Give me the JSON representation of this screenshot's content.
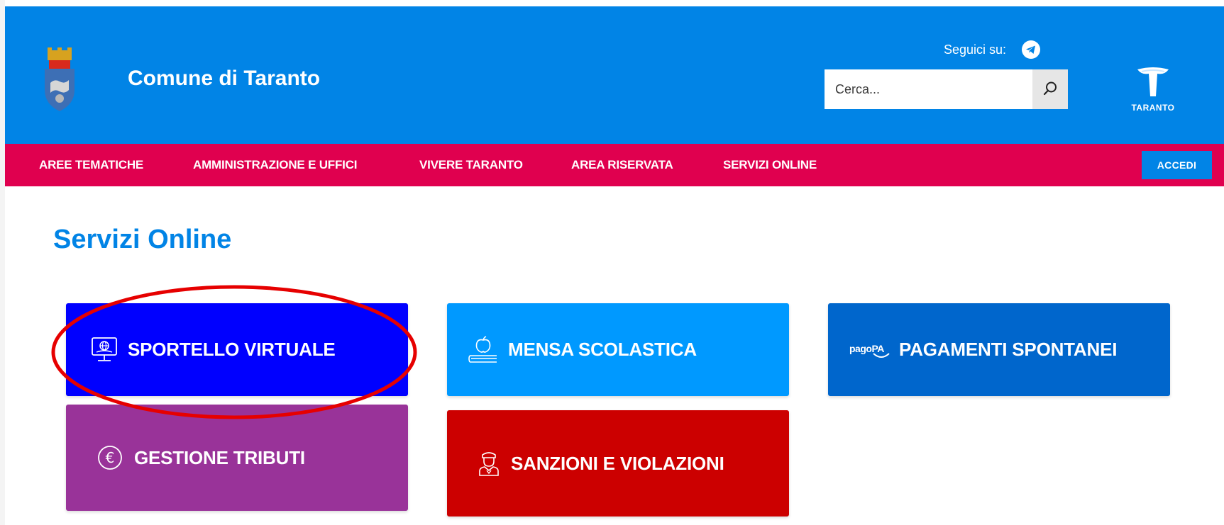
{
  "header": {
    "site_title": "Comune di Taranto",
    "follow_label": "Seguici su:",
    "search_placeholder": "Cerca...",
    "brand_text": "TARANTO"
  },
  "nav": {
    "items": [
      {
        "label": "AREE TEMATICHE"
      },
      {
        "label": "AMMINISTRAZIONE E UFFICI"
      },
      {
        "label": "VIVERE TARANTO"
      },
      {
        "label": "AREA RISERVATA"
      },
      {
        "label": "SERVIZI ONLINE"
      }
    ],
    "login_label": "ACCEDI"
  },
  "main": {
    "title": "Servizi Online",
    "tiles": [
      {
        "label": "SPORTELLO VIRTUALE",
        "icon": "monitor-globe-icon",
        "color": "#0000ff"
      },
      {
        "label": "MENSA SCOLASTICA",
        "icon": "apple-books-icon",
        "color": "#0099ff"
      },
      {
        "label": "PAGAMENTI SPONTANEI",
        "icon": "pagopa-icon",
        "icon_text": "pagoPA",
        "color": "#0066cc"
      },
      {
        "label": "GESTIONE TRIBUTI",
        "icon": "euro-icon",
        "icon_text": "€",
        "color": "#993399"
      },
      {
        "label": "SANZIONI E VIOLAZIONI",
        "icon": "police-officer-icon",
        "color": "#cc0000"
      }
    ]
  },
  "colors": {
    "header_bg": "#0184e6",
    "nav_bg": "#e0004f",
    "annotation": "#e60000"
  }
}
